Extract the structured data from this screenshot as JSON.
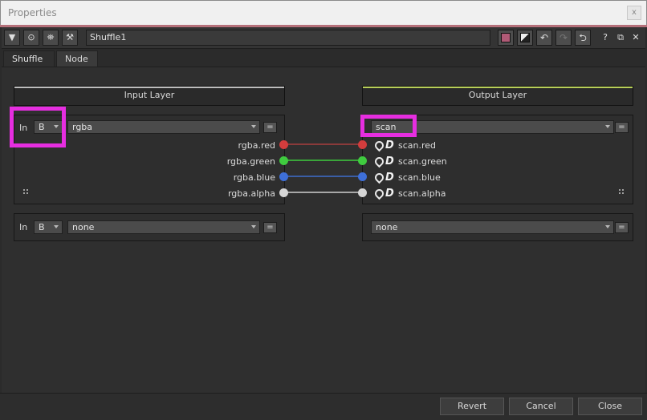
{
  "window": {
    "title": "Properties",
    "close_glyph": "x"
  },
  "node_toolbar": {
    "node_name": "Shuffle1",
    "help_label": "?",
    "icons": [
      "collapse-arrow-icon",
      "viewer-icon",
      "node-icon",
      "wrench-icon",
      "color-swatch-icon",
      "mask-icon",
      "undo-icon",
      "redo-icon",
      "revert-icon",
      "help-icon",
      "float-icon",
      "close-icon"
    ],
    "colors": {
      "node_color": "#b05a76"
    }
  },
  "tabs": [
    {
      "label": "Shuffle"
    },
    {
      "label": "Node"
    }
  ],
  "input": {
    "header": "Input Layer",
    "header_color": "#bdbdbd",
    "row1": {
      "in_label": "In",
      "b_value": "B",
      "layer_value": "rgba",
      "eq": "="
    },
    "row2": {
      "in_label": "In",
      "b_value": "B",
      "layer_value": "none",
      "eq": "="
    },
    "channels": [
      "rgba.red",
      "rgba.green",
      "rgba.blue",
      "rgba.alpha"
    ]
  },
  "output": {
    "header": "Output Layer",
    "header_color": "#b8cf5a",
    "row1": {
      "layer_value": "scan",
      "eq": "="
    },
    "row2": {
      "layer_value": "none",
      "eq": "="
    },
    "channels": [
      "scan.red",
      "scan.green",
      "scan.blue",
      "scan.alpha"
    ]
  },
  "channel_colors": [
    "#d23d3d",
    "#3fcb3f",
    "#3e6fd8",
    "#d6d6d6"
  ],
  "highlight_color": "#e62ee0",
  "footer": {
    "revert": "Revert",
    "cancel": "Cancel",
    "close": "Close"
  }
}
